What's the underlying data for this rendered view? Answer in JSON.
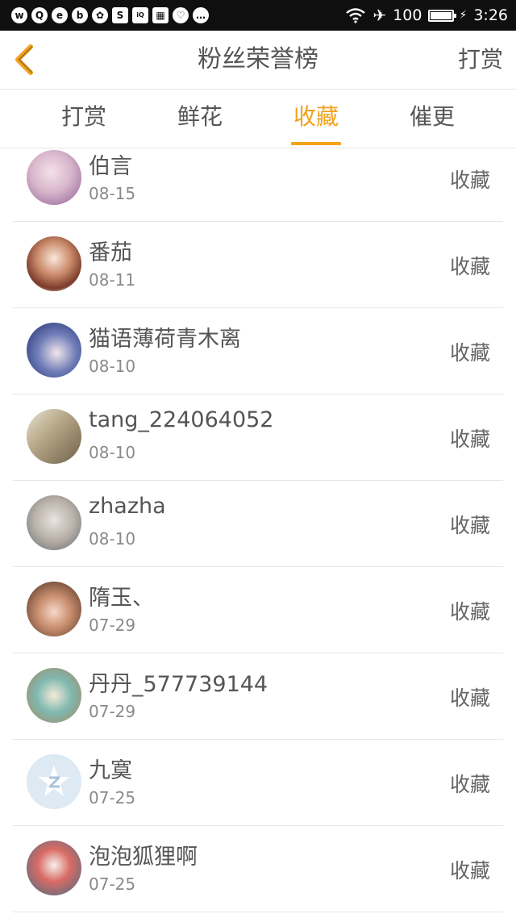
{
  "status_bar": {
    "battery": "100",
    "time": "3:26",
    "left_icons": [
      "weibo-icon",
      "qq-icon",
      "app-icon",
      "baidu-icon",
      "paw-icon",
      "s-icon",
      "iqiyi-icon",
      "grid-icon",
      "heart-icon",
      "chat-icon"
    ]
  },
  "header": {
    "title": "粉丝荣誉榜",
    "action_label": "打赏"
  },
  "tabs": [
    {
      "label": "打赏",
      "active": false
    },
    {
      "label": "鲜花",
      "active": false
    },
    {
      "label": "收藏",
      "active": true
    },
    {
      "label": "催更",
      "active": false
    }
  ],
  "fans": [
    {
      "name": "伯言",
      "date": "08-15",
      "action": "收藏"
    },
    {
      "name": "番茄",
      "date": "08-11",
      "action": "收藏"
    },
    {
      "name": "猫语薄荷青木离",
      "date": "08-10",
      "action": "收藏"
    },
    {
      "name": "tang_224064052",
      "date": "08-10",
      "action": "收藏"
    },
    {
      "name": "zhazha",
      "date": "08-10",
      "action": "收藏"
    },
    {
      "name": "隋玉、",
      "date": "07-29",
      "action": "收藏"
    },
    {
      "name": "丹丹_577739144",
      "date": "07-29",
      "action": "收藏"
    },
    {
      "name": "九寞",
      "date": "07-25",
      "action": "收藏"
    },
    {
      "name": "泡泡狐狸啊",
      "date": "07-25",
      "action": "收藏"
    }
  ],
  "colors": {
    "accent": "#f3a21a",
    "text_primary": "#555555",
    "text_secondary": "#8a8a8a",
    "divider": "#e6e6e6"
  }
}
